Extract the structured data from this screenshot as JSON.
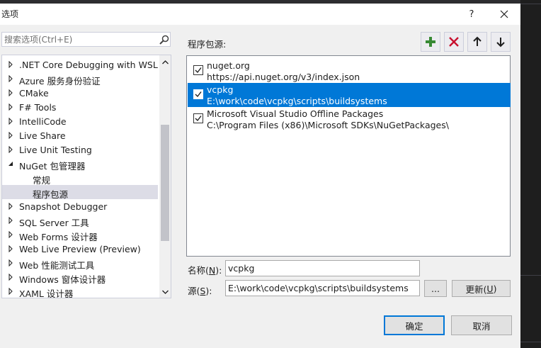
{
  "dialog": {
    "title": "选项",
    "help_label": "?"
  },
  "search": {
    "placeholder": "搜索选项(Ctrl+E)"
  },
  "tree": {
    "items": [
      {
        "label": ".NET Core Debugging with WSL",
        "expanded": false
      },
      {
        "label": "Azure 服务身份验证",
        "expanded": false
      },
      {
        "label": "CMake",
        "expanded": false
      },
      {
        "label": "F# Tools",
        "expanded": false
      },
      {
        "label": "IntelliCode",
        "expanded": false
      },
      {
        "label": "Live Share",
        "expanded": false
      },
      {
        "label": "Live Unit Testing",
        "expanded": false
      },
      {
        "label": "NuGet 包管理器",
        "expanded": true
      },
      {
        "label": "常规",
        "child": true
      },
      {
        "label": "程序包源",
        "child": true,
        "selected": true
      },
      {
        "label": "Snapshot Debugger",
        "expanded": false
      },
      {
        "label": "SQL Server 工具",
        "expanded": false
      },
      {
        "label": "Web Forms 设计器",
        "expanded": false
      },
      {
        "label": "Web Live Preview (Preview)",
        "expanded": false
      },
      {
        "label": "Web 性能测试工具",
        "expanded": false
      },
      {
        "label": "Windows 窗体设计器",
        "expanded": false
      },
      {
        "label": "XAML 设计器",
        "expanded": false
      }
    ]
  },
  "sources": {
    "label": "程序包源:",
    "items": [
      {
        "name": "nuget.org",
        "url": "https://api.nuget.org/v3/index.json",
        "checked": true,
        "selected": false
      },
      {
        "name": "vcpkg",
        "url": "E:\\work\\code\\vcpkg\\scripts\\buildsystems",
        "checked": true,
        "selected": true
      },
      {
        "name": "Microsoft Visual Studio Offline Packages",
        "url": "C:\\Program Files (x86)\\Microsoft SDKs\\NuGetPackages\\",
        "checked": true,
        "selected": false
      }
    ]
  },
  "form": {
    "name_label_pre": "名称(",
    "name_label_key": "N",
    "name_label_post": "):",
    "name_value": "vcpkg",
    "source_label_pre": "源(",
    "source_label_key": "S",
    "source_label_post": "):",
    "source_value": "E:\\work\\code\\vcpkg\\scripts\\buildsystems",
    "browse_label": "...",
    "update_label_pre": "更新(",
    "update_label_key": "U",
    "update_label_post": ")"
  },
  "footer": {
    "ok_label": "确定",
    "cancel_label": "取消"
  },
  "colors": {
    "selection": "#0078d7",
    "add_icon": "#388a34",
    "remove_icon": "#c8102e"
  }
}
